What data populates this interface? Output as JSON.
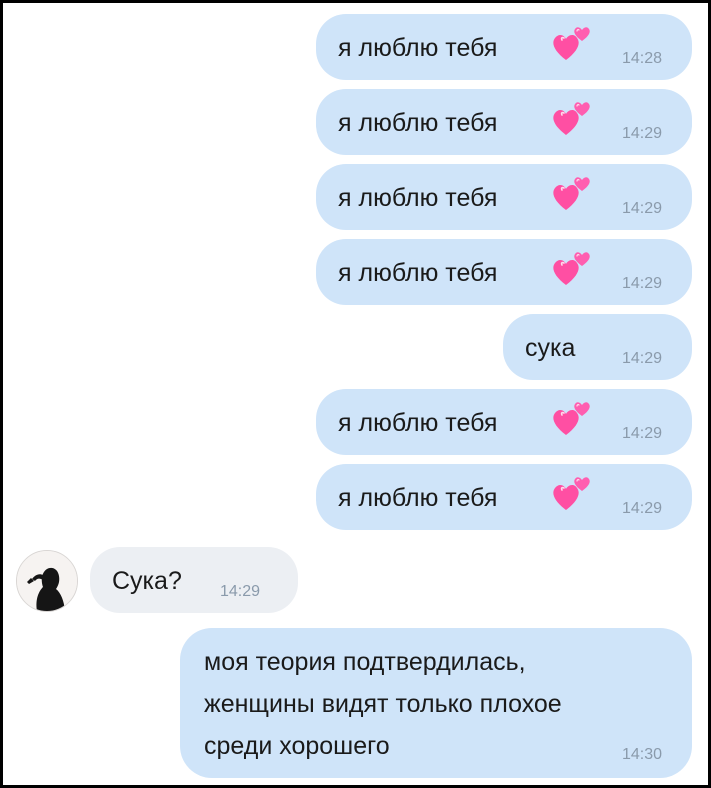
{
  "chat": {
    "messages": [
      {
        "text": "я люблю тебя",
        "time": "14:28",
        "emoji": "two-hearts"
      },
      {
        "text": "я люблю тебя",
        "time": "14:29",
        "emoji": "two-hearts"
      },
      {
        "text": "я люблю тебя",
        "time": "14:29",
        "emoji": "two-hearts"
      },
      {
        "text": "я люблю тебя",
        "time": "14:29",
        "emoji": "two-hearts"
      },
      {
        "text": "сука",
        "time": "14:29"
      },
      {
        "text": "я люблю тебя",
        "time": "14:29",
        "emoji": "two-hearts"
      },
      {
        "text": "я люблю тебя",
        "time": "14:29",
        "emoji": "two-hearts"
      },
      {
        "text": "Сука?",
        "time": "14:29",
        "incoming": true
      },
      {
        "lines": [
          "моя теория подтвердилась,",
          "женщины видят только плохое",
          "среди хорошего"
        ],
        "time": "14:30"
      }
    ]
  },
  "colors": {
    "outgoing_bubble": "#cfe4f9",
    "incoming_bubble": "#eceff3",
    "timestamp": "#8a9aab",
    "heart": "#ff4fa3",
    "frame": "#000000"
  }
}
